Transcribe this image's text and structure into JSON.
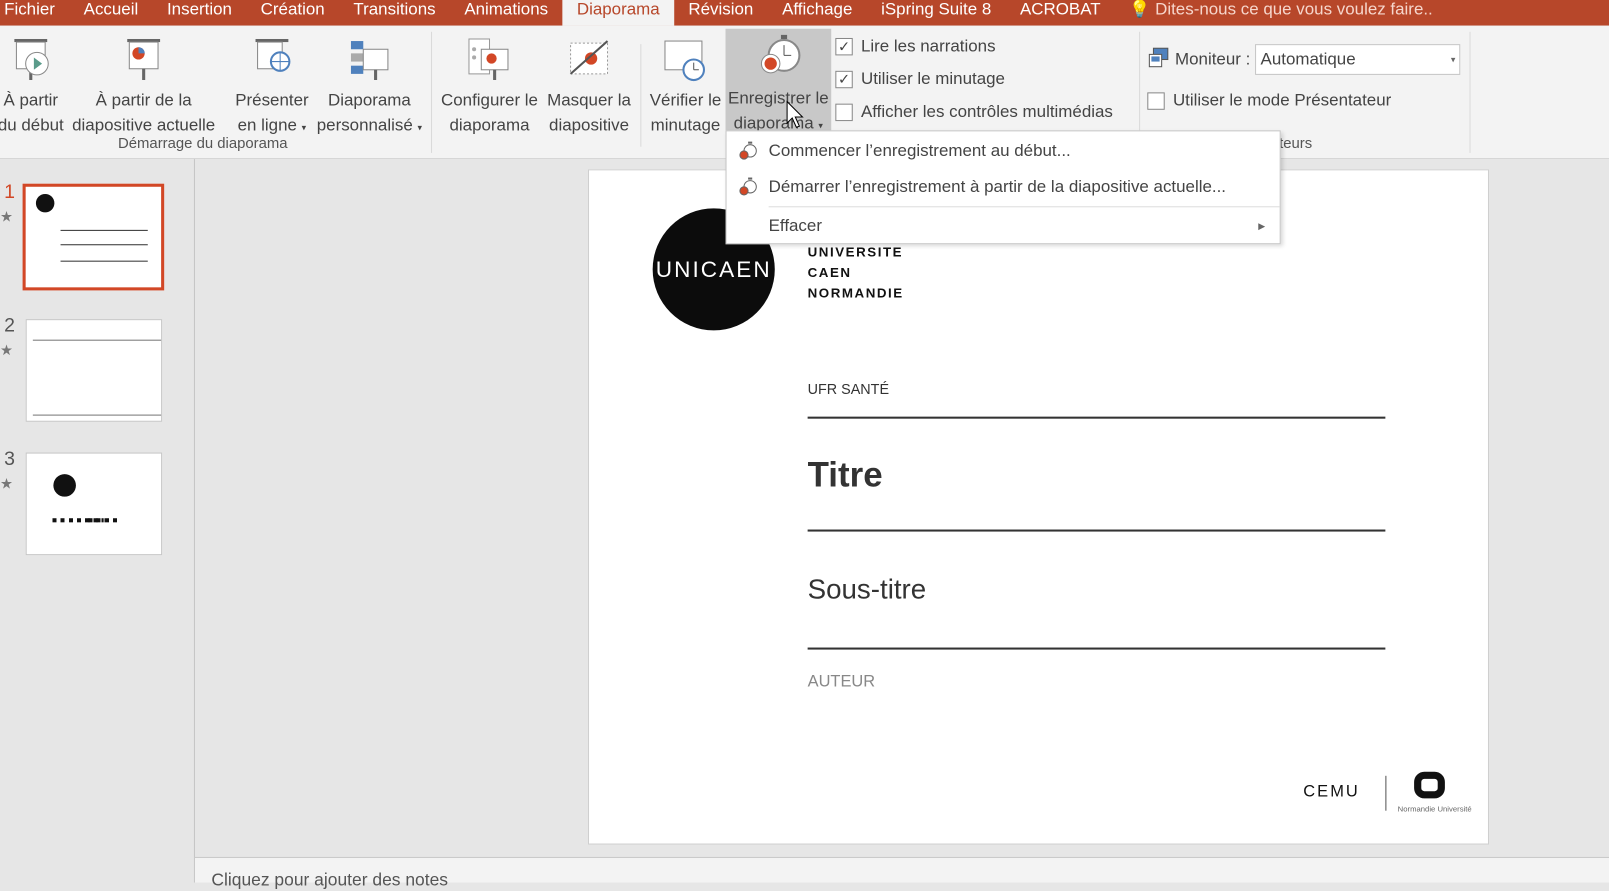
{
  "tabs": [
    "Fichier",
    "Accueil",
    "Insertion",
    "Création",
    "Transitions",
    "Animations",
    "Diaporama",
    "Révision",
    "Affichage",
    "iSpring Suite 8",
    "ACROBAT"
  ],
  "tell_me": "Dites-nous ce que vous voulez faire..",
  "ribbon": {
    "btn_from_start": [
      "À partir",
      "du début"
    ],
    "btn_from_current": [
      "À partir de la",
      "diapositive actuelle"
    ],
    "btn_present_online": [
      "Présenter",
      "en ligne"
    ],
    "btn_custom_show": [
      "Diaporama",
      "personnalisé"
    ],
    "group_start": "Démarrage du diaporama",
    "btn_setup": [
      "Configurer le",
      "diaporama"
    ],
    "btn_hide": [
      "Masquer la",
      "diapositive"
    ],
    "btn_rehearse": [
      "Vérifier le",
      "minutage"
    ],
    "btn_record": [
      "Enregistrer le",
      "diaporama"
    ],
    "chk_narrations": {
      "label": "Lire les narrations",
      "checked": true
    },
    "chk_timings": {
      "label": "Utiliser le minutage",
      "checked": true
    },
    "chk_media": {
      "label": "Afficher les contrôles multimédias",
      "checked": false
    },
    "monitor_label": "Moniteur :",
    "monitor_value": "Automatique",
    "chk_presenter": {
      "label": "Utiliser le mode Présentateur",
      "checked": false
    },
    "group_monitors": "Moniteurs"
  },
  "dropdown": {
    "items": [
      "Commencer l’enregistrement au début...",
      "Démarrer l’enregistrement à partir de la diapositive actuelle...",
      "Effacer"
    ]
  },
  "slides": [
    {
      "num": "1"
    },
    {
      "num": "2"
    },
    {
      "num": "3"
    }
  ],
  "slide": {
    "logo_text": "UNICAEN",
    "univ": [
      "UNIVERSITE",
      "CAEN",
      "NORMANDIE"
    ],
    "ufr": "UFR SANTÉ",
    "title": "Titre",
    "subtitle": "Sous-titre",
    "author": "AUTEUR",
    "cemu": "CEMU",
    "normandie": "Normandie Université"
  },
  "notes_placeholder": "Cliquez pour ajouter des notes"
}
